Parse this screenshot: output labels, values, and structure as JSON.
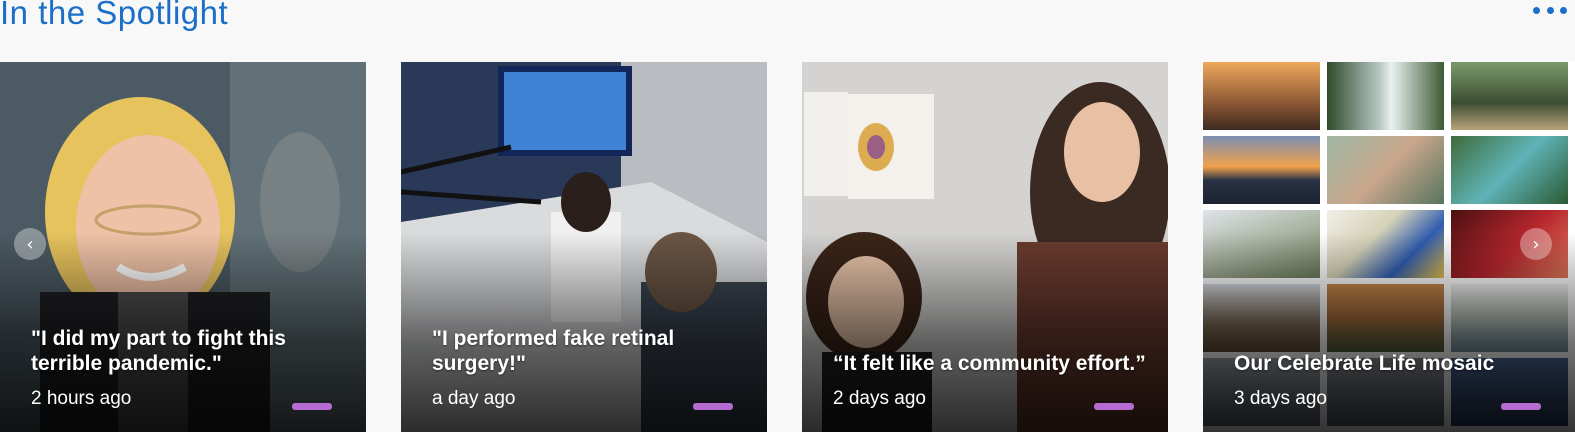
{
  "section": {
    "title": "In the Spotlight",
    "menu_icon": "more-horizontal-icon"
  },
  "cards": [
    {
      "headline": "\"I did my part to fight this terrible pandemic.\"",
      "time": "2 hours ago"
    },
    {
      "headline": "\"I performed fake retinal surgery!\"",
      "time": "a day ago"
    },
    {
      "headline": "“It felt like a community effort.”",
      "time": "2 days ago"
    },
    {
      "headline": "Our Celebrate Life mosaic",
      "time": "3 days ago"
    }
  ],
  "carousel": {
    "prev_icon": "chevron-left-icon",
    "next_icon": "chevron-right-icon",
    "prev_glyph": "‹",
    "next_glyph": "›"
  },
  "colors": {
    "accent": "#1b6fc8",
    "indicator": "#b66bd0"
  }
}
